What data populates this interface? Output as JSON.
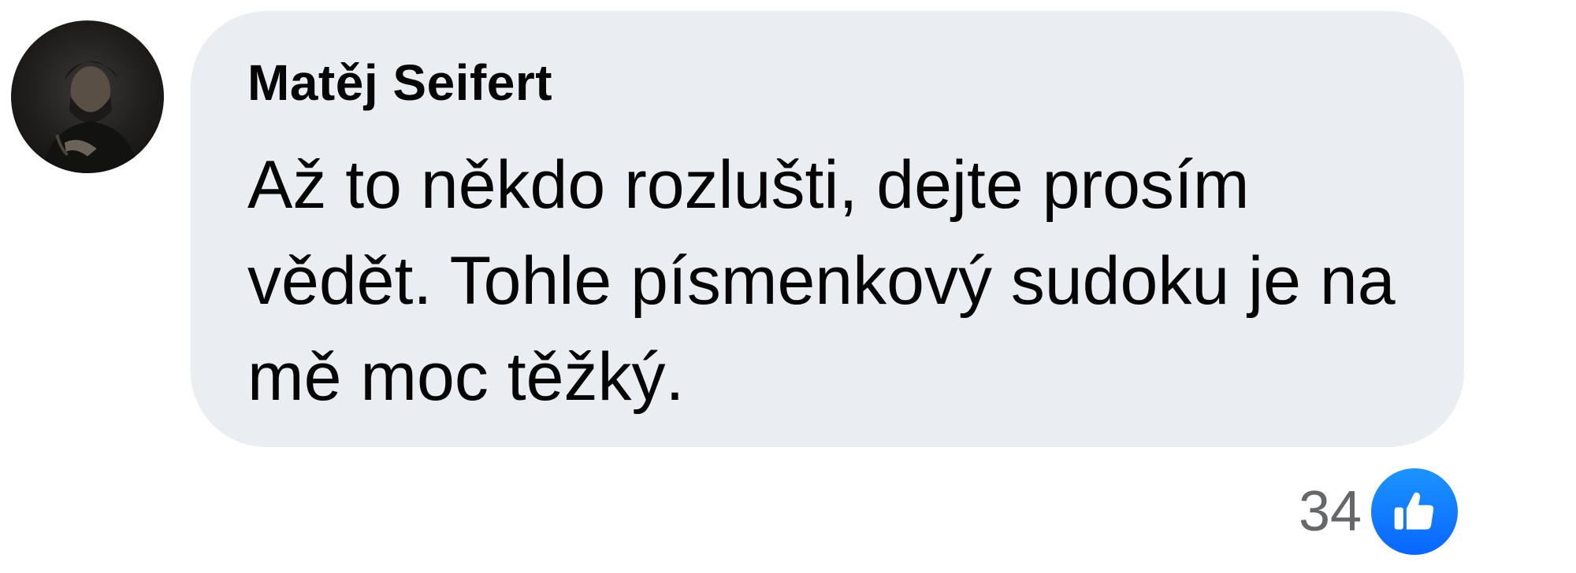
{
  "comment": {
    "author": "Matěj Seifert",
    "text": "Až to někdo rozlušti, dejte prosím vědět. Tohle písmenkový sudoku je na mě moc těžký.",
    "avatar_icon": "user-photo",
    "reactions": {
      "count": "34",
      "icon": "like-icon",
      "color": "#0866ff"
    }
  },
  "colors": {
    "bubble": "#eaedf1",
    "text": "#050505",
    "count": "#65676b"
  }
}
